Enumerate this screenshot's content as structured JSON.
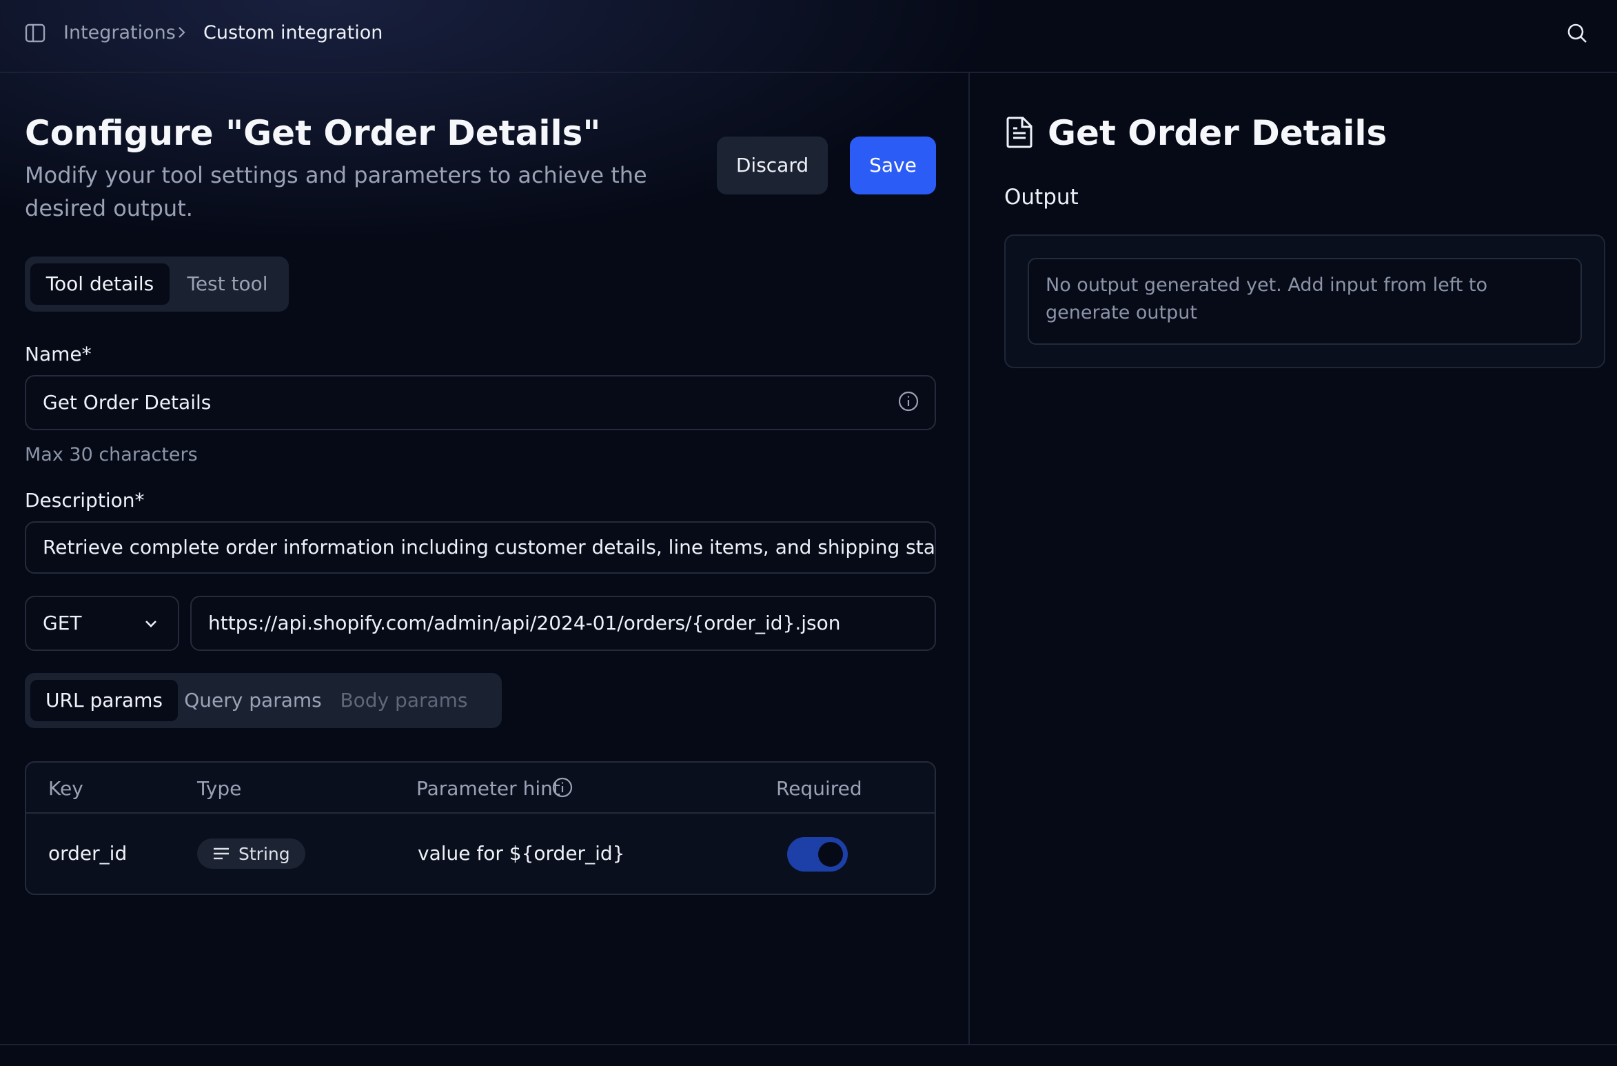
{
  "breadcrumb": {
    "items": [
      "Integrations",
      "Custom integration"
    ]
  },
  "header": {
    "title": "Configure \"Get Order Details\"",
    "subtitle": "Modify your tool settings and parameters to achieve the desired output.",
    "discard_label": "Discard",
    "save_label": "Save"
  },
  "tool_tabs": [
    {
      "label": "Tool details",
      "active": true
    },
    {
      "label": "Test tool",
      "active": false
    }
  ],
  "form": {
    "name_label": "Name*",
    "name_value": "Get Order Details",
    "name_helper": "Max 30 characters",
    "description_label": "Description*",
    "description_value": "Retrieve complete order information including customer details, line items, and shipping status",
    "method": "GET",
    "url": "https://api.shopify.com/admin/api/2024-01/orders/{order_id}.json"
  },
  "param_tabs": [
    {
      "label": "URL params",
      "state": "active"
    },
    {
      "label": "Query params",
      "state": "inactive"
    },
    {
      "label": "Body params",
      "state": "disabled"
    }
  ],
  "params_table": {
    "headers": [
      "Key",
      "Type",
      "Parameter hint",
      "Required"
    ],
    "rows": [
      {
        "key": "order_id",
        "type": "String",
        "hint": "value for ${order_id}",
        "required": true
      }
    ]
  },
  "output_panel": {
    "title": "Get Order Details",
    "label": "Output",
    "placeholder": "No output generated yet. Add input from left to generate output"
  },
  "colors": {
    "background": "#060a17",
    "accent": "#2b5cf5",
    "toggle_on": "#1d3fa8"
  },
  "icons": [
    "sidebar-toggle-icon",
    "chevron-right-icon",
    "search-icon",
    "info-icon",
    "chevron-down-icon",
    "text-lines-icon",
    "document-icon"
  ]
}
